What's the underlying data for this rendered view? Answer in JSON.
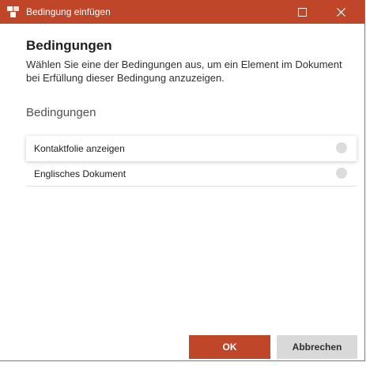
{
  "window": {
    "title": "Bedingung einfügen",
    "accent_color": "#c0462a",
    "controls": {
      "maximize_icon": "maximize-icon",
      "close_icon": "close-icon"
    }
  },
  "content": {
    "heading": "Bedingungen",
    "description": "Wählen Sie eine der Bedingungen aus, um ein Element im Dokument bei Erfüllung dieser Bedingung anzuzeigen.",
    "section_title": "Bedingungen"
  },
  "conditions": [
    {
      "label": "Kontaktfolie anzeigen",
      "selected": true
    },
    {
      "label": "Englisches Dokument",
      "selected": false
    }
  ],
  "buttons": {
    "ok_label": "OK",
    "cancel_label": "Abbrechen"
  }
}
